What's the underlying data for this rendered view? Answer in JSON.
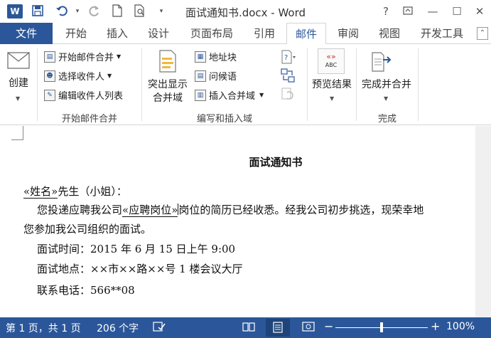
{
  "window": {
    "app_icon": "W",
    "title": "面试通知书.docx - Word",
    "help": "?",
    "controls": [
      "⬒",
      "—",
      "☐"
    ]
  },
  "quick_access": {
    "save_icon": "💾",
    "undo_icon": "↶",
    "redo_icon": "↻",
    "new_icon": "🗋",
    "preview_icon": "🔍",
    "more_icon": "▾"
  },
  "tabs": {
    "file": "文件",
    "items": [
      "开始",
      "插入",
      "设计",
      "页面布局",
      "引用",
      "邮件",
      "审阅",
      "视图",
      "开发工具"
    ],
    "active_index": 5
  },
  "ribbon": {
    "create_label": "创建",
    "start_group": {
      "start_merge": "开始邮件合并",
      "select_recipients": "选择收件人",
      "edit_recipients": "编辑收件人列表",
      "label": "开始邮件合并"
    },
    "write_group": {
      "highlight_line1": "突出显示",
      "highlight_line2": "合并域",
      "address_block": "地址块",
      "greeting": "问候语",
      "insert_field": "插入合并域",
      "label": "编写和插入域"
    },
    "preview_group": {
      "preview": "预览结果",
      "abc": "ABC"
    },
    "finish_group": {
      "finish_merge": "完成并合并",
      "label": "完成"
    }
  },
  "document": {
    "title": "面试通知书",
    "line1_field": "«姓名»",
    "line1_text": "先生（小姐）：",
    "line2_text_a": "您投递应聘我公司",
    "line2_field": "«应聘岗位»",
    "line2_text_b": "岗位的简历已经收悉。经我公司初步挑选，现荣幸地",
    "line3_text": "您参加我公司组织的面试。",
    "line4_text": "面试时间：2015 年 6 月 15 日上午 9:00",
    "line5_text": "面试地点：××市××路××号 1 楼会议大厅",
    "line6_text": "联系电话：566**08"
  },
  "status": {
    "page": "第 1 页，共 1 页",
    "words": "206 个字",
    "zoom_minus": "−",
    "zoom_plus": "+",
    "zoom": "100%"
  },
  "colors": {
    "accent": "#2b579a"
  }
}
